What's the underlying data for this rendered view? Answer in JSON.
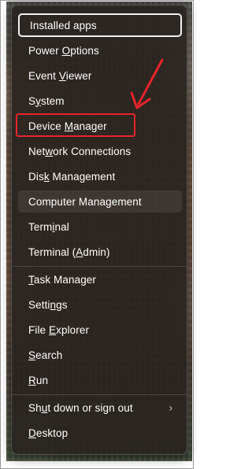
{
  "menu": {
    "items": [
      {
        "pre": "",
        "ul": "",
        "post": "Installed apps"
      },
      {
        "pre": "Power ",
        "ul": "O",
        "post": "ptions"
      },
      {
        "pre": "Event ",
        "ul": "V",
        "post": "iewer"
      },
      {
        "pre": "S",
        "ul": "y",
        "post": "stem"
      },
      {
        "pre": "Device ",
        "ul": "M",
        "post": "anager"
      },
      {
        "pre": "Net",
        "ul": "w",
        "post": "ork Connections"
      },
      {
        "pre": "Dis",
        "ul": "k",
        "post": " Management"
      },
      {
        "pre": "Computer Mana",
        "ul": "g",
        "post": "ement"
      },
      {
        "pre": "Term",
        "ul": "i",
        "post": "nal"
      },
      {
        "pre": "Terminal (",
        "ul": "A",
        "post": "dmin)"
      },
      {
        "pre": "",
        "ul": "T",
        "post": "ask Manager"
      },
      {
        "pre": "Setti",
        "ul": "n",
        "post": "gs"
      },
      {
        "pre": "File ",
        "ul": "E",
        "post": "xplorer"
      },
      {
        "pre": "",
        "ul": "S",
        "post": "earch"
      },
      {
        "pre": "",
        "ul": "R",
        "post": "un"
      },
      {
        "pre": "Sh",
        "ul": "u",
        "post": "t down or sign out"
      },
      {
        "pre": "",
        "ul": "D",
        "post": "esktop"
      }
    ],
    "submenu_chevron": "›"
  },
  "annotation": {
    "highlight_color": "#e8242b",
    "arrow_color": "#e8242b",
    "highlighted_item": "Device Manager"
  }
}
